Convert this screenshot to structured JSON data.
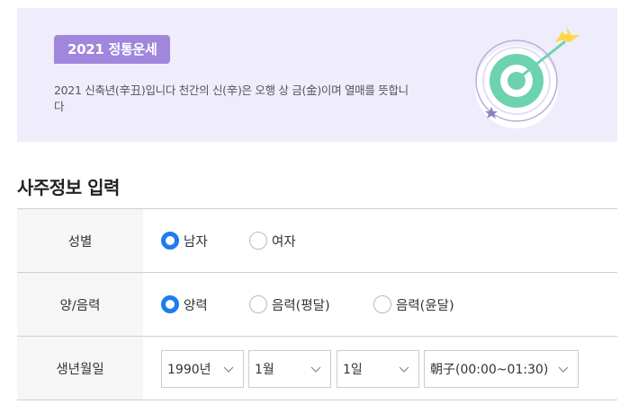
{
  "banner": {
    "badge": "2021 정통운세",
    "description": "2021 신축년(辛丑)입니다 천간의 신(辛)은 오행 상 금(金)이며 열매를 뜻합니다"
  },
  "section_title": "사주정보 입력",
  "form": {
    "gender": {
      "label": "성별",
      "options": [
        {
          "label": "남자",
          "selected": true
        },
        {
          "label": "여자",
          "selected": false
        }
      ]
    },
    "calendar": {
      "label": "양/음력",
      "options": [
        {
          "label": "양력",
          "selected": true
        },
        {
          "label": "음력(평달)",
          "selected": false
        },
        {
          "label": "음력(윤달)",
          "selected": false
        }
      ]
    },
    "birth": {
      "label": "생년월일",
      "year": "1990년",
      "month": "1월",
      "day": "1일",
      "hour": "朝子(00:00~01:30)"
    }
  },
  "colors": {
    "accent": "#1d7cf0",
    "badge": "#a086dd",
    "banner_bg": "#efedfc",
    "target_green": "#6cd2b0"
  }
}
